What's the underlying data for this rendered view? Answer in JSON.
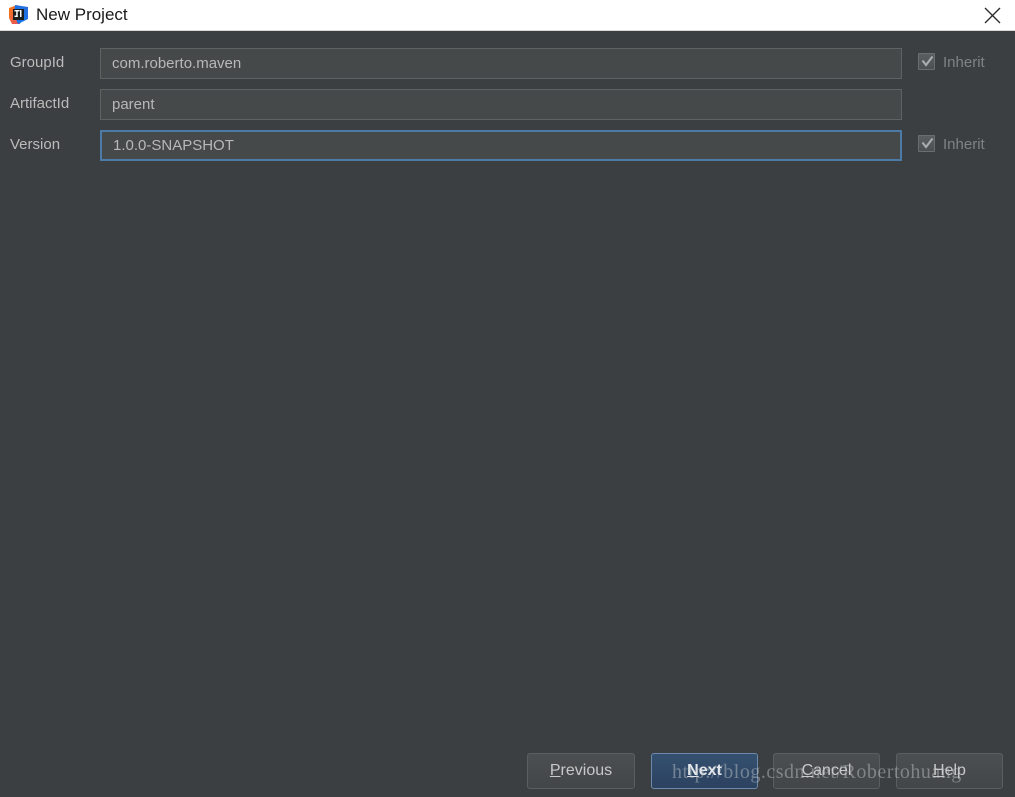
{
  "window": {
    "title": "New Project",
    "app_icon": "intellij-idea-icon",
    "close_icon": "close-icon",
    "titlebar_bg": "#ffffff",
    "body_bg": "#3c3f41"
  },
  "form": {
    "fields": [
      {
        "label": "GroupId",
        "value": "com.roberto.maven",
        "placeholder": "",
        "focused": false,
        "inherit": {
          "label": "Inherit",
          "checked": true,
          "disabled": true,
          "visible": true
        }
      },
      {
        "label": "ArtifactId",
        "value": "parent",
        "placeholder": "",
        "focused": false,
        "inherit": {
          "label": "",
          "checked": false,
          "disabled": true,
          "visible": false
        }
      },
      {
        "label": "Version",
        "value": "1.0.0-SNAPSHOT",
        "placeholder": "",
        "focused": true,
        "inherit": {
          "label": "Inherit",
          "checked": true,
          "disabled": true,
          "visible": true
        }
      }
    ],
    "focus_border_color": "#4d7ba8",
    "input_bg": "#45494a",
    "label_color": "#bbbbbb"
  },
  "footer": {
    "buttons": [
      {
        "label": "Previous",
        "mnemonic": "P",
        "default": false
      },
      {
        "label": "Next",
        "mnemonic": "N",
        "default": true
      },
      {
        "label": "Cancel",
        "mnemonic": "C",
        "default": false
      },
      {
        "label": "Help",
        "mnemonic": "H",
        "default": false
      }
    ],
    "default_button_color": "#2b4260"
  },
  "watermark": {
    "text": "http://blog.csdn.net/Robertohuang"
  }
}
